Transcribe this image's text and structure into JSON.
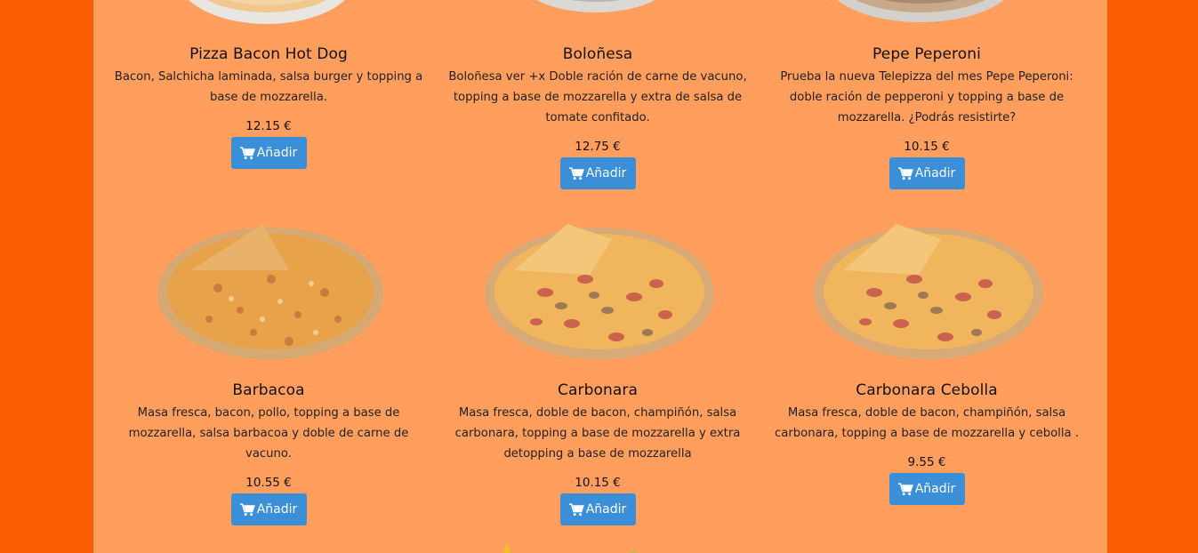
{
  "currency": "€",
  "add_label": "Añadir",
  "products": [
    {
      "name": "Pizza Bacon Hot Dog",
      "description": "Bacon, Salchicha laminada, salsa burger y topping a base de mozzarella.",
      "price": "12.15 €",
      "image": "pizza-bacon-hot-dog-image"
    },
    {
      "name": "Boloñesa",
      "description": "Boloñesa ver +x Doble ración de carne de vacuno, topping a base de mozzarella y extra de salsa de tomate confitado.",
      "price": "12.75 €",
      "image": "pizza-bolonesa-image"
    },
    {
      "name": "Pepe Peperoni",
      "description": "Prueba la nueva Telepizza del mes Pepe Peperoni: doble ración de pepperoni y topping a base de mozzarella. ¿Podrás resistirte?",
      "price": "10.15 €",
      "image": "pizza-pepe-peperoni-image"
    },
    {
      "name": "Barbacoa",
      "description": "Masa fresca, bacon, pollo, topping a base de mozzarella, salsa barbacoa y doble de carne de vacuno.",
      "price": "10.55 €",
      "image": "pizza-barbacoa-image"
    },
    {
      "name": "Carbonara",
      "description": "Masa fresca, doble de bacon, champiñón, salsa carbonara, topping a base de mozzarella y extra detopping a base de mozzarella",
      "price": "10.15 €",
      "image": "pizza-carbonara-image"
    },
    {
      "name": "Carbonara Cebolla",
      "description": "Masa fresca, doble de bacon, champiñón, salsa carbonara, topping a base de mozzarella y cebolla .",
      "price": "9.55 €",
      "image": "pizza-carbonara-cebolla-image"
    }
  ],
  "colors": {
    "outer_background": "#fa5d03",
    "content_background": "#ff9e5d",
    "button": "#3a8fd8",
    "button_text": "#ffffff"
  }
}
